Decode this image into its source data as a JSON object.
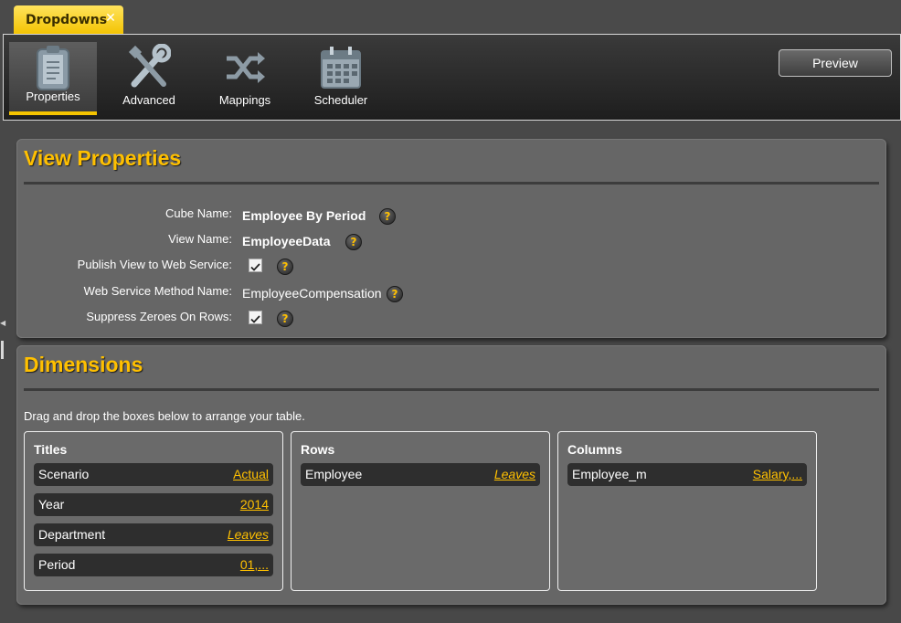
{
  "tab": {
    "label": "Dropdowns",
    "close_glyph": "✕"
  },
  "toolbar": {
    "tools": [
      {
        "label": "Properties",
        "icon": "clipboard-icon",
        "active": true
      },
      {
        "label": "Advanced",
        "icon": "wrench-screwdriver-icon",
        "active": false
      },
      {
        "label": "Mappings",
        "icon": "shuffle-arrows-icon",
        "active": false
      },
      {
        "label": "Scheduler",
        "icon": "calendar-icon",
        "active": false
      }
    ],
    "preview_label": "Preview"
  },
  "view_properties": {
    "title": "View Properties",
    "rows": [
      {
        "label": "Cube Name:",
        "value": "Employee By Period"
      },
      {
        "label": "View Name:",
        "value": "EmployeeData"
      },
      {
        "label": "Publish View to Web Service:",
        "checked": true
      },
      {
        "label": "Web Service Method Name:",
        "value": "EmployeeCompensation"
      },
      {
        "label": "Suppress Zeroes On Rows:",
        "checked": true
      }
    ],
    "help_glyph": "?"
  },
  "dimensions": {
    "title": "Dimensions",
    "hint": "Drag and drop the boxes below to arrange your table.",
    "boxes": [
      {
        "title": "Titles",
        "items": [
          {
            "name": "Scenario",
            "value": "Actual"
          },
          {
            "name": "Year",
            "value": "2014"
          },
          {
            "name": "Department",
            "value": "Leaves"
          },
          {
            "name": "Period",
            "value": "01,..."
          }
        ]
      },
      {
        "title": "Rows",
        "items": [
          {
            "name": "Employee",
            "value": "Leaves"
          }
        ]
      },
      {
        "title": "Columns",
        "items": [
          {
            "name": "Employee_m",
            "value": "Salary,..."
          }
        ]
      }
    ]
  },
  "colors": {
    "accent": "#ffc000",
    "tab": "#f3c300",
    "panel": "#666666",
    "background": "#484848"
  }
}
